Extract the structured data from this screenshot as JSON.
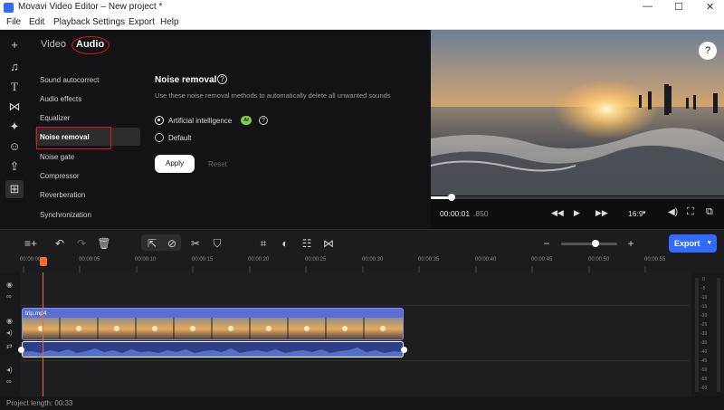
{
  "window": {
    "title": "Movavi Video Editor – New project *",
    "minimize": "—",
    "maximize": "☐",
    "close": "✕"
  },
  "menu": [
    "File",
    "Edit",
    "Playback",
    "Settings",
    "Export",
    "Help"
  ],
  "panel": {
    "tabs": {
      "video": "Video",
      "audio": "Audio"
    },
    "items": [
      "Sound autocorrect",
      "Audio effects",
      "Equalizer",
      "Noise removal",
      "Noise gate",
      "Compressor",
      "Reverberation",
      "Synchronization"
    ],
    "selected": "Noise removal",
    "heading": "Noise removal",
    "description": "Use these noise removal methods to automatically delete all unwanted sounds",
    "options": [
      {
        "label": "Artificial intelligence",
        "badge": "AI",
        "checked": true
      },
      {
        "label": "Default",
        "checked": false
      }
    ],
    "apply": "Apply",
    "reset": "Reset"
  },
  "preview": {
    "timecode_main": "00:00:01",
    "timecode_frac": ".850",
    "aspect": "16:9",
    "progress": 0.07
  },
  "timeline": {
    "export_label": "Export",
    "ruler": [
      "00:00:00",
      "00:00:05",
      "00:00:10",
      "00:00:15",
      "00:00:20",
      "00:00:25",
      "00:00:30",
      "00:00:35",
      "00:00:40",
      "00:00:45",
      "00:00:50",
      "00:00:55"
    ],
    "clip_name": "trip.mp4",
    "meter_labels": [
      "0",
      "-5",
      "-10",
      "-15",
      "-20",
      "-25",
      "-30",
      "-35",
      "-40",
      "-45",
      "-50",
      "-55",
      "-60"
    ],
    "zoom_level": 0.6
  },
  "status": {
    "project_length": "Project length: 00:33"
  },
  "colors": {
    "accent": "#2f6bff",
    "highlight": "#e3141a",
    "clip": "#5a6fd6",
    "ai_badge": "#7bd142"
  }
}
